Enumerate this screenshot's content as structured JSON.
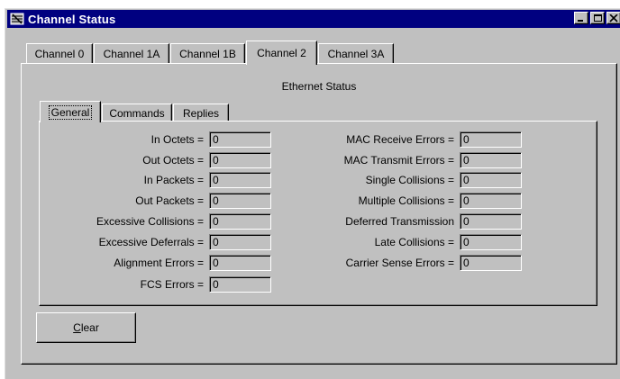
{
  "window": {
    "title": "Channel Status"
  },
  "outer_tabs": [
    {
      "label": "Channel 0"
    },
    {
      "label": "Channel 1A"
    },
    {
      "label": "Channel 1B"
    },
    {
      "label": "Channel 2",
      "active": true
    },
    {
      "label": "Channel 3A"
    }
  ],
  "section": {
    "title": "Ethernet Status"
  },
  "inner_tabs": [
    {
      "label": "General",
      "active": true
    },
    {
      "label": "Commands"
    },
    {
      "label": "Replies"
    }
  ],
  "left_stats": [
    {
      "label": "In Octets =",
      "value": "0"
    },
    {
      "label": "Out Octets =",
      "value": "0"
    },
    {
      "label": "In Packets =",
      "value": "0"
    },
    {
      "label": "Out Packets =",
      "value": "0"
    },
    {
      "label": "Excessive Collisions =",
      "value": "0"
    },
    {
      "label": "Excessive Deferrals =",
      "value": "0"
    },
    {
      "label": "Alignment Errors =",
      "value": "0"
    },
    {
      "label": "FCS Errors =",
      "value": "0"
    }
  ],
  "right_stats": [
    {
      "label": "MAC Receive Errors =",
      "value": "0"
    },
    {
      "label": "MAC Transmit Errors =",
      "value": "0"
    },
    {
      "label": "Single Collisions =",
      "value": "0"
    },
    {
      "label": "Multiple Collisions =",
      "value": "0"
    },
    {
      "label": "Deferred Transmission",
      "value": "0"
    },
    {
      "label": "Late Collisions =",
      "value": "0"
    },
    {
      "label": "Carrier Sense Errors =",
      "value": "0"
    }
  ],
  "clear_button": {
    "mnemonic": "C",
    "rest": "lear"
  }
}
